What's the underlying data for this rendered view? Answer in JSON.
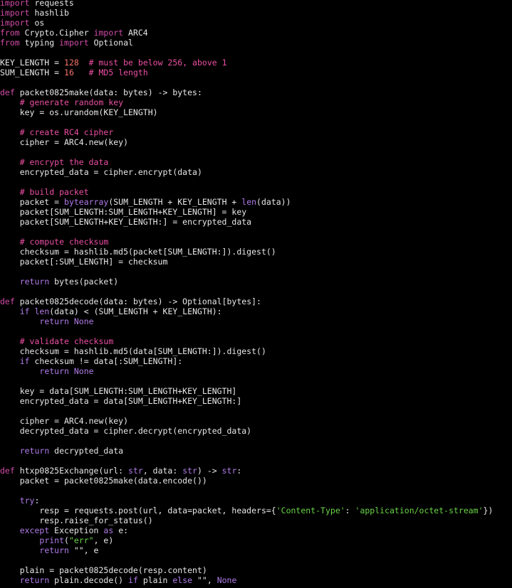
{
  "colors": {
    "background": "#000000",
    "text": "#e8e8e8",
    "keyword": "#d24ba8",
    "control_keyword": "#b07be8",
    "number": "#f5736a",
    "comment": "#ec4fa3",
    "string": "#69d447",
    "builtin": "#b07be8"
  },
  "code_lines": [
    [
      [
        "kw",
        "import"
      ],
      [
        "t",
        " requests"
      ]
    ],
    [
      [
        "kw",
        "import"
      ],
      [
        "t",
        " hashlib"
      ]
    ],
    [
      [
        "kw",
        "import"
      ],
      [
        "t",
        " os"
      ]
    ],
    [
      [
        "kw",
        "from"
      ],
      [
        "t",
        " Crypto.Cipher "
      ],
      [
        "kw",
        "import"
      ],
      [
        "t",
        " ARC4"
      ]
    ],
    [
      [
        "kw",
        "from"
      ],
      [
        "t",
        " typing "
      ],
      [
        "kw",
        "import"
      ],
      [
        "t",
        " Optional"
      ]
    ],
    [],
    [
      [
        "t",
        "KEY_LENGTH = "
      ],
      [
        "num",
        "128"
      ],
      [
        "t",
        "  "
      ],
      [
        "cm",
        "# must be below 256, above 1"
      ]
    ],
    [
      [
        "t",
        "SUM_LENGTH = "
      ],
      [
        "num",
        "16"
      ],
      [
        "t",
        "   "
      ],
      [
        "cm",
        "# MD5 length"
      ]
    ],
    [],
    [
      [
        "kw",
        "def"
      ],
      [
        "t",
        " packet0825make(data: bytes) -> bytes:"
      ]
    ],
    [
      [
        "t",
        "    "
      ],
      [
        "cm",
        "# generate random key"
      ]
    ],
    [
      [
        "t",
        "    key = os.urandom(KEY_LENGTH)"
      ]
    ],
    [],
    [
      [
        "t",
        "    "
      ],
      [
        "cm",
        "# create RC4 cipher"
      ]
    ],
    [
      [
        "t",
        "    cipher = ARC4.new(key)"
      ]
    ],
    [],
    [
      [
        "t",
        "    "
      ],
      [
        "cm",
        "# encrypt the data"
      ]
    ],
    [
      [
        "t",
        "    encrypted_data = cipher.encrypt(data)"
      ]
    ],
    [],
    [
      [
        "t",
        "    "
      ],
      [
        "cm",
        "# build packet"
      ]
    ],
    [
      [
        "t",
        "    packet = "
      ],
      [
        "bi",
        "bytearray"
      ],
      [
        "t",
        "(SUM_LENGTH + KEY_LENGTH + "
      ],
      [
        "bi",
        "len"
      ],
      [
        "t",
        "(data))"
      ]
    ],
    [
      [
        "t",
        "    packet[SUM_LENGTH:SUM_LENGTH+KEY_LENGTH] = key"
      ]
    ],
    [
      [
        "t",
        "    packet[SUM_LENGTH+KEY_LENGTH:] = encrypted_data"
      ]
    ],
    [],
    [
      [
        "t",
        "    "
      ],
      [
        "cm",
        "# compute checksum"
      ]
    ],
    [
      [
        "t",
        "    checksum = hashlib.md5(packet[SUM_LENGTH:]).digest()"
      ]
    ],
    [
      [
        "t",
        "    packet[:SUM_LENGTH] = checksum"
      ]
    ],
    [],
    [
      [
        "t",
        "    "
      ],
      [
        "ctl",
        "return"
      ],
      [
        "t",
        " bytes(packet)"
      ]
    ],
    [],
    [
      [
        "kw",
        "def"
      ],
      [
        "t",
        " packet0825decode(data: bytes) -> Optional[bytes]:"
      ]
    ],
    [
      [
        "t",
        "    "
      ],
      [
        "ctl",
        "if"
      ],
      [
        "t",
        " "
      ],
      [
        "bi",
        "len"
      ],
      [
        "t",
        "(data) < (SUM_LENGTH + KEY_LENGTH):"
      ]
    ],
    [
      [
        "t",
        "        "
      ],
      [
        "ctl",
        "return"
      ],
      [
        "t",
        " "
      ],
      [
        "bi",
        "None"
      ]
    ],
    [],
    [
      [
        "t",
        "    "
      ],
      [
        "cm",
        "# validate checksum"
      ]
    ],
    [
      [
        "t",
        "    checksum = hashlib.md5(data[SUM_LENGTH:]).digest()"
      ]
    ],
    [
      [
        "t",
        "    "
      ],
      [
        "ctl",
        "if"
      ],
      [
        "t",
        " checksum != data[:SUM_LENGTH]:"
      ]
    ],
    [
      [
        "t",
        "        "
      ],
      [
        "ctl",
        "return"
      ],
      [
        "t",
        " "
      ],
      [
        "bi",
        "None"
      ]
    ],
    [],
    [
      [
        "t",
        "    key = data[SUM_LENGTH:SUM_LENGTH+KEY_LENGTH]"
      ]
    ],
    [
      [
        "t",
        "    encrypted_data = data[SUM_LENGTH+KEY_LENGTH:]"
      ]
    ],
    [],
    [
      [
        "t",
        "    cipher = ARC4.new(key)"
      ]
    ],
    [
      [
        "t",
        "    decrypted_data = cipher.decrypt(encrypted_data)"
      ]
    ],
    [],
    [
      [
        "t",
        "    "
      ],
      [
        "ctl",
        "return"
      ],
      [
        "t",
        " decrypted_data"
      ]
    ],
    [],
    [
      [
        "kw",
        "def"
      ],
      [
        "t",
        " htxp0825Exchange(url: "
      ],
      [
        "bi",
        "str"
      ],
      [
        "t",
        ", data: "
      ],
      [
        "bi",
        "str"
      ],
      [
        "t",
        ") -> "
      ],
      [
        "bi",
        "str"
      ],
      [
        "t",
        ":"
      ]
    ],
    [
      [
        "t",
        "    packet = packet0825make(data.encode())"
      ]
    ],
    [],
    [
      [
        "t",
        "    "
      ],
      [
        "ctl",
        "try"
      ],
      [
        "t",
        ":"
      ]
    ],
    [
      [
        "t",
        "        resp = requests.post(url, data=packet, headers={"
      ],
      [
        "str",
        "'Content-Type'"
      ],
      [
        "t",
        ": "
      ],
      [
        "str",
        "'application/octet-stream'"
      ],
      [
        "t",
        "})"
      ]
    ],
    [
      [
        "t",
        "        resp.raise_for_status()"
      ]
    ],
    [
      [
        "t",
        "    "
      ],
      [
        "ctl",
        "except"
      ],
      [
        "t",
        " Exception "
      ],
      [
        "ctl",
        "as"
      ],
      [
        "t",
        " e:"
      ]
    ],
    [
      [
        "t",
        "        "
      ],
      [
        "bi",
        "print"
      ],
      [
        "t",
        "("
      ],
      [
        "str",
        "\"err\""
      ],
      [
        "t",
        ", e)"
      ]
    ],
    [
      [
        "t",
        "        "
      ],
      [
        "ctl",
        "return"
      ],
      [
        "t",
        " \"\", e"
      ]
    ],
    [],
    [
      [
        "t",
        "    plain = packet0825decode(resp.content)"
      ]
    ],
    [
      [
        "t",
        "    "
      ],
      [
        "ctl",
        "return"
      ],
      [
        "t",
        " plain.decode() "
      ],
      [
        "ctl",
        "if"
      ],
      [
        "t",
        " plain "
      ],
      [
        "ctl",
        "else"
      ],
      [
        "t",
        " \"\", "
      ],
      [
        "bi",
        "None"
      ]
    ]
  ]
}
